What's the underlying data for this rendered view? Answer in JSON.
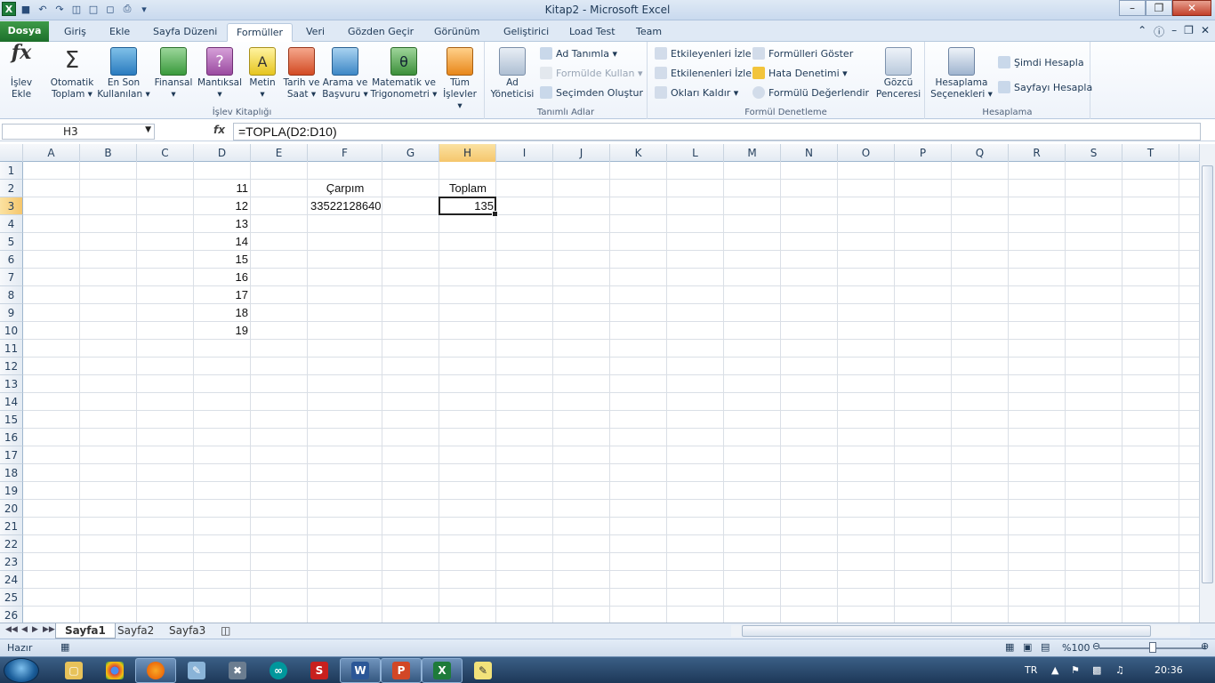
{
  "window": {
    "title": "Kitap2 - Microsoft Excel"
  },
  "tabs": [
    {
      "label": "Dosya"
    },
    {
      "label": "Giriş"
    },
    {
      "label": "Ekle"
    },
    {
      "label": "Sayfa Düzeni"
    },
    {
      "label": "Formüller"
    },
    {
      "label": "Veri"
    },
    {
      "label": "Gözden Geçir"
    },
    {
      "label": "Görünüm"
    },
    {
      "label": "Geliştirici"
    },
    {
      "label": "Load Test"
    },
    {
      "label": "Team"
    }
  ],
  "ribbon": {
    "islev_kitapligi": {
      "label": "İşlev Kitaplığı",
      "buttons": [
        {
          "l1": "İşlev",
          "l2": "Ekle"
        },
        {
          "l1": "Otomatik",
          "l2": "Toplam ▾"
        },
        {
          "l1": "En Son",
          "l2": "Kullanılan ▾"
        },
        {
          "l1": "Finansal",
          "l2": "▾"
        },
        {
          "l1": "Mantıksal",
          "l2": "▾"
        },
        {
          "l1": "Metin",
          "l2": "▾"
        },
        {
          "l1": "Tarih ve",
          "l2": "Saat ▾"
        },
        {
          "l1": "Arama ve",
          "l2": "Başvuru ▾"
        },
        {
          "l1": "Matematik ve",
          "l2": "Trigonometri ▾"
        },
        {
          "l1": "Tüm",
          "l2": "İşlevler ▾"
        }
      ]
    },
    "tanimli_adlar": {
      "label": "Tanımlı Adlar",
      "ad_yoneticisi": {
        "l1": "Ad",
        "l2": "Yöneticisi"
      },
      "ad_tanimla": "Ad Tanımla ▾",
      "formulde_kullan": "Formülde Kullan ▾",
      "secimden_olustur": "Seçimden Oluştur"
    },
    "formul_denetleme": {
      "label": "Formül Denetleme",
      "etkileyenleri_izle": "Etkileyenleri İzle",
      "etkilenenleri_izle": "Etkilenenleri İzle",
      "oklari_kaldir": "Okları Kaldır ▾",
      "formulleri_goster": "Formülleri Göster",
      "hata_denetimi": "Hata Denetimi ▾",
      "formulu_degerlendir": "Formülü Değerlendir",
      "gozcu": {
        "l1": "Gözcü",
        "l2": "Penceresi"
      }
    },
    "hesaplama": {
      "label": "Hesaplama",
      "secenekler": {
        "l1": "Hesaplama",
        "l2": "Seçenekleri ▾"
      },
      "simdi_hesapla": "Şimdi Hesapla",
      "sayfayi_hesapla": "Sayfayı Hesapla"
    }
  },
  "formula_bar": {
    "name_box": "H3",
    "fx": "fx",
    "formula": "=TOPLA(D2:D10)"
  },
  "columns": [
    "A",
    "B",
    "C",
    "D",
    "E",
    "F",
    "G",
    "H",
    "I",
    "J",
    "K",
    "L",
    "M",
    "N",
    "O",
    "P",
    "Q",
    "R",
    "S",
    "T"
  ],
  "selected_column": "H",
  "selected_row": 3,
  "rows": [
    "1",
    "2",
    "3",
    "4",
    "5",
    "6",
    "7",
    "8",
    "9",
    "10",
    "11",
    "12",
    "13",
    "14",
    "15",
    "16",
    "17",
    "18",
    "19",
    "20",
    "21",
    "22",
    "23",
    "24",
    "25",
    "26"
  ],
  "cells": {
    "D2": "11",
    "D3": "12",
    "D4": "13",
    "D5": "14",
    "D6": "15",
    "D7": "16",
    "D8": "17",
    "D9": "18",
    "D10": "19",
    "F2": "Çarpım",
    "F3": "33522128640",
    "H2": "Toplam",
    "H3": "135"
  },
  "sheets": [
    "Sayfa1",
    "Sayfa2",
    "Sayfa3"
  ],
  "active_sheet": "Sayfa1",
  "status": {
    "ready": "Hazır",
    "zoom": "%100"
  },
  "taskbar": {
    "lang": "TR",
    "time": "20:36"
  }
}
